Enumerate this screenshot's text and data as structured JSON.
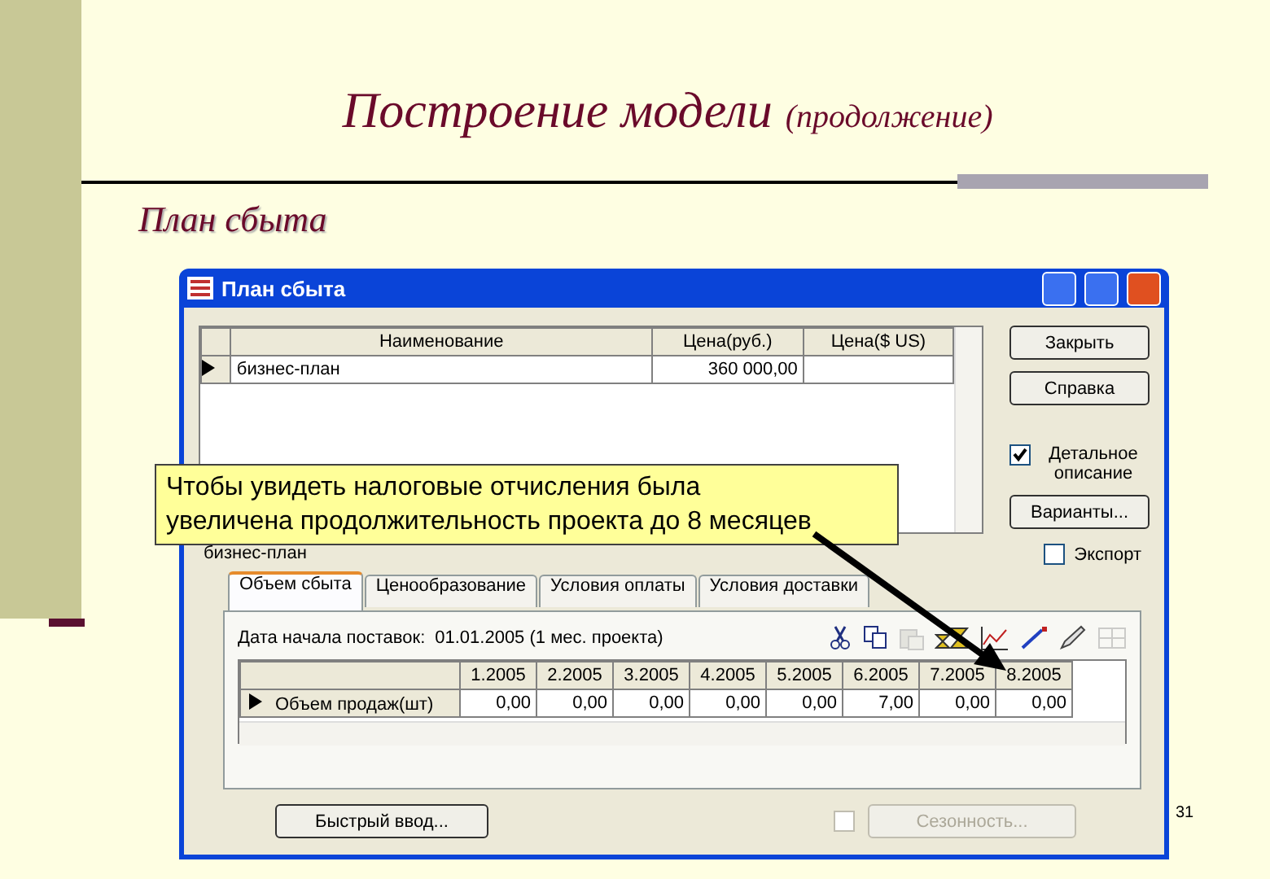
{
  "slide": {
    "title": "Построение модели",
    "title_note": "(продолжение)",
    "subtitle": "План сбыта",
    "page_number": "31"
  },
  "window": {
    "title": "План сбыта"
  },
  "products": {
    "columns": [
      "Наименование",
      "Цена(руб.)",
      "Цена($ US)"
    ],
    "rows": [
      {
        "name": "бизнес-план",
        "price_rub": "360 000,00",
        "selected": true
      }
    ]
  },
  "side_controls": [
    {
      "kind": "button",
      "label": "Закрыть"
    },
    {
      "kind": "button",
      "label": "Справка"
    },
    {
      "kind": "checkbox",
      "label": "Детальное описание",
      "checked": true
    },
    {
      "kind": "button",
      "label": "Варианты..."
    }
  ],
  "current_item": "бизнес-план",
  "export": {
    "label": "Экспорт",
    "checked": false
  },
  "tabs": [
    {
      "label": "Объем сбыта",
      "selected": true
    },
    {
      "label": "Ценообразование",
      "selected": false
    },
    {
      "label": "Условия оплаты",
      "selected": false
    },
    {
      "label": "Условия доставки",
      "selected": false
    }
  ],
  "start_date": {
    "label": "Дата начала поставок:",
    "value": "01.01.2005 (1 мес. проекта)"
  },
  "toolbar": [
    {
      "kind": "cut",
      "disabled": false
    },
    {
      "kind": "copy",
      "disabled": false
    },
    {
      "kind": "paste",
      "disabled": true
    },
    {
      "kind": "hourglass",
      "disabled": false
    },
    {
      "kind": "chart",
      "disabled": false
    },
    {
      "kind": "wand",
      "disabled": false
    },
    {
      "kind": "pencil",
      "disabled": false
    },
    {
      "kind": "grid",
      "disabled": true
    }
  ],
  "sales": {
    "columns": [
      "1.2005",
      "2.2005",
      "3.2005",
      "4.2005",
      "5.2005",
      "6.2005",
      "7.2005",
      "8.2005"
    ],
    "rows": [
      {
        "label": "Объем продаж(шт)",
        "selected": true,
        "values": [
          "0,00",
          "0,00",
          "0,00",
          "0,00",
          "0,00",
          "7,00",
          "0,00",
          "0,00"
        ]
      }
    ]
  },
  "quick_entry": {
    "label": "Быстрый ввод..."
  },
  "seasonality": {
    "label": "Сезонность...",
    "checked": false,
    "disabled": true
  },
  "callout": {
    "lines": [
      "Чтобы увидеть налоговые отчисления была",
      "увеличена продолжительность проекта до 8 месяцев"
    ]
  }
}
